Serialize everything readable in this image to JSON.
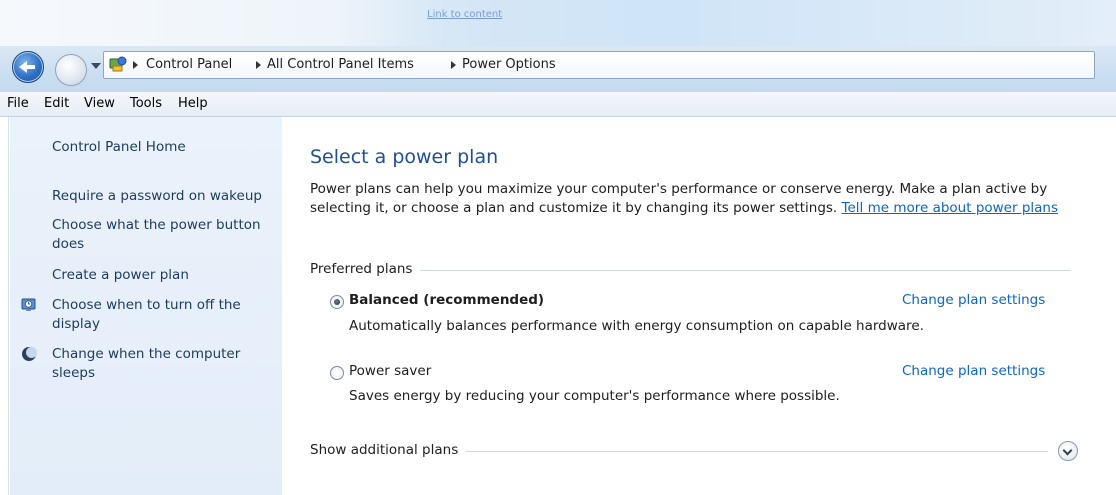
{
  "window": {
    "title_link": "Link to content"
  },
  "address": {
    "crumbs": [
      "Control Panel",
      "All Control Panel Items",
      "Power Options"
    ]
  },
  "menu": [
    "File",
    "Edit",
    "View",
    "Tools",
    "Help"
  ],
  "sidebar": {
    "home": "Control Panel Home",
    "links": [
      "Require a password on wakeup",
      "Choose what the power button does",
      "Create a power plan",
      "Choose when to turn off the display",
      "Change when the computer sleeps"
    ]
  },
  "main": {
    "title": "Select a power plan",
    "description": "Power plans can help you maximize your computer's performance or conserve energy. Make a plan active by selecting it, or choose a plan and customize it by changing its power settings.",
    "more_link": "Tell me more about power plans",
    "preferred_label": "Preferred plans",
    "plans": [
      {
        "name": "Balanced (recommended)",
        "description": "Automatically balances performance with energy consumption on capable hardware.",
        "change_link": "Change plan settings",
        "selected": true
      },
      {
        "name": "Power saver",
        "description": "Saves energy by reducing your computer's performance where possible.",
        "change_link": "Change plan settings",
        "selected": false
      }
    ],
    "show_additional": "Show additional plans"
  },
  "colors": {
    "link_blue": "#0b66c8",
    "title_blue": "#1e4e99",
    "sidebar_bg": "#e3edf9"
  },
  "icons": {
    "display": "monitor-clock-icon",
    "sleep": "moon-icon",
    "control_panel": "control-panel-icon"
  }
}
